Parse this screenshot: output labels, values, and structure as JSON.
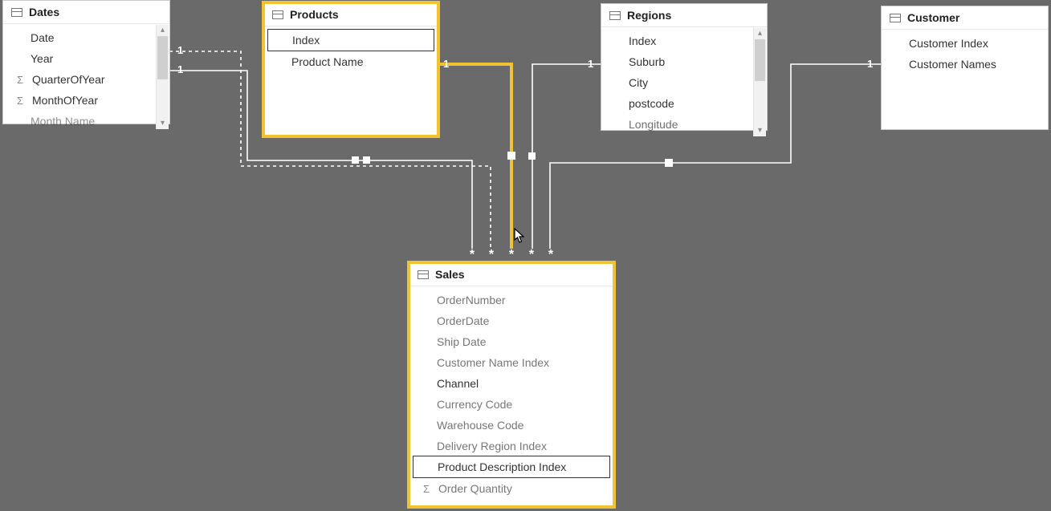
{
  "tables": {
    "dates": {
      "title": "Dates",
      "fields": [
        "Date",
        "Year",
        "QuarterOfYear",
        "MonthOfYear",
        "Month Name"
      ],
      "sigma": {
        "QuarterOfYear": true,
        "MonthOfYear": true
      }
    },
    "products": {
      "title": "Products",
      "fields": [
        "Index",
        "Product Name"
      ]
    },
    "regions": {
      "title": "Regions",
      "fields": [
        "Index",
        "Suburb",
        "City",
        "postcode",
        "Longitude"
      ]
    },
    "customer": {
      "title": "Customer",
      "fields": [
        "Customer Index",
        "Customer Names"
      ]
    },
    "sales": {
      "title": "Sales",
      "fields": [
        "OrderNumber",
        "OrderDate",
        "Ship Date",
        "Customer Name Index",
        "Channel",
        "Currency Code",
        "Warehouse Code",
        "Delivery Region Index",
        "Product Description Index",
        "Order Quantity"
      ],
      "selected_field": "Product Description Index",
      "sigma": {
        "Order Quantity": true
      }
    }
  },
  "cardinality": {
    "dates_one": "1",
    "dates_one_b": "1",
    "products_one": "1",
    "regions_one": "1",
    "customer_one": "1",
    "many": "*"
  }
}
